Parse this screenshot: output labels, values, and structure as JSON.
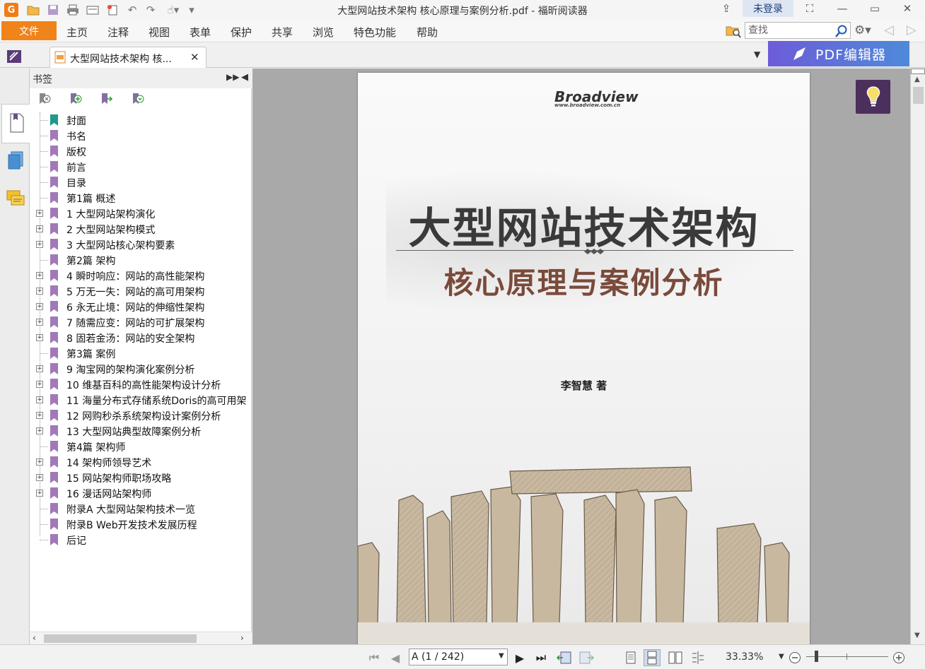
{
  "window": {
    "title": "大型网站技术架构 核心原理与案例分析.pdf - 福昕阅读器",
    "login": "未登录"
  },
  "menu": {
    "file": "文件",
    "items": [
      "主页",
      "注释",
      "视图",
      "表单",
      "保护",
      "共享",
      "浏览",
      "特色功能",
      "帮助"
    ],
    "search_placeholder": "查找"
  },
  "tab": {
    "label": "大型网站技术架构 核...",
    "pdf_editor": "PDF编辑器"
  },
  "bookmarks": {
    "title": "书签",
    "items": [
      {
        "label": "封面",
        "expandable": false
      },
      {
        "label": "书名",
        "expandable": false
      },
      {
        "label": "版权",
        "expandable": false
      },
      {
        "label": "前言",
        "expandable": false
      },
      {
        "label": "目录",
        "expandable": false
      },
      {
        "label": "第1篇 概述",
        "expandable": false
      },
      {
        "label": "1 大型网站架构演化",
        "expandable": true
      },
      {
        "label": "2 大型网站架构模式",
        "expandable": true
      },
      {
        "label": "3 大型网站核心架构要素",
        "expandable": true
      },
      {
        "label": "第2篇 架构",
        "expandable": false
      },
      {
        "label": "4 瞬时响应：网站的高性能架构",
        "expandable": true
      },
      {
        "label": "5 万无一失：网站的高可用架构",
        "expandable": true
      },
      {
        "label": "6 永无止境：网站的伸缩性架构",
        "expandable": true
      },
      {
        "label": "7 随需应变：网站的可扩展架构",
        "expandable": true
      },
      {
        "label": "8 固若金汤：网站的安全架构",
        "expandable": true
      },
      {
        "label": "第3篇 案例",
        "expandable": false
      },
      {
        "label": "9 淘宝网的架构演化案例分析",
        "expandable": true
      },
      {
        "label": "10 维基百科的高性能架构设计分析",
        "expandable": true
      },
      {
        "label": "11 海量分布式存储系统Doris的高可用架",
        "expandable": true
      },
      {
        "label": "12 网购秒杀系统架构设计案例分析",
        "expandable": true
      },
      {
        "label": "13 大型网站典型故障案例分析",
        "expandable": true
      },
      {
        "label": "第4篇 架构师",
        "expandable": false
      },
      {
        "label": "14 架构师领导艺术",
        "expandable": true
      },
      {
        "label": "15 网站架构师职场攻略",
        "expandable": true
      },
      {
        "label": "16 漫话网站架构师",
        "expandable": true
      },
      {
        "label": "附录A 大型网站架构技术一览",
        "expandable": false
      },
      {
        "label": "附录B Web开发技术发展历程",
        "expandable": false
      },
      {
        "label": "后记",
        "expandable": false
      }
    ]
  },
  "document": {
    "publisher": "Broadview",
    "publisher_url": "www.broadview.com.cn",
    "book_title": "大型网站技术架构",
    "book_subtitle": "核心原理与案例分析",
    "author": "李智慧  著"
  },
  "status": {
    "page_value": "A (1 / 242)",
    "zoom": "33.33%"
  },
  "colors": {
    "accent_orange": "#f0831a",
    "bookmark_purple": "#a07ab8",
    "bookmark_teal": "#1d9b8a",
    "lightbulb_bg": "#4b2f5c"
  }
}
